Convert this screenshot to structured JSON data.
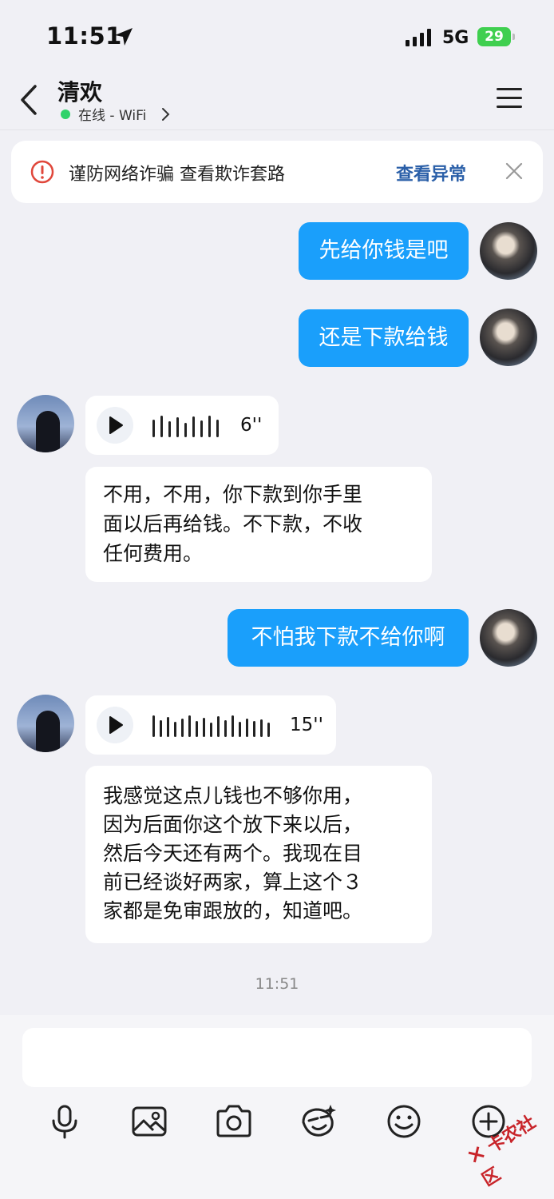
{
  "status_bar": {
    "time": "11:51",
    "network": "5G",
    "battery": "29"
  },
  "nav": {
    "contact_name": "清欢",
    "online_status": "在线 - WiFi"
  },
  "banner": {
    "text": "谨防网络诈骗 查看欺诈套路",
    "link": "查看异常"
  },
  "messages": {
    "m1": "先给你钱是吧",
    "m2": "还是下款给钱",
    "v1_duration": "6''",
    "t1": [
      "不用，不用，你下款到你手里",
      "面以后再给钱。不下款，不收",
      "任何费用。"
    ],
    "m3": "不怕我下款不给你啊",
    "v2_duration": "15''",
    "t2": [
      "我感觉这点儿钱也不够你用，",
      "因为后面你这个放下来以后，",
      "然后今天还有两个。我现在目",
      "前已经谈好两家，算上这个３",
      "家都是免审跟放的，知道吧。"
    ]
  },
  "timestamp": "11:51",
  "watermark": "卡农社区",
  "colors": {
    "bubble_me": "#1a9ffb",
    "link": "#2a5fa8",
    "online": "#2fd26a",
    "battery": "#3fcf4f"
  }
}
